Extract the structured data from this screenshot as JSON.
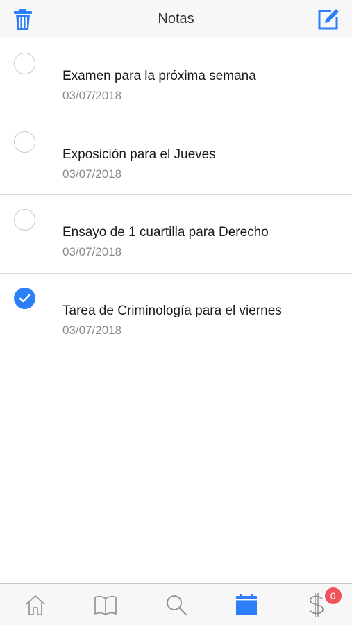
{
  "header": {
    "title": "Notas",
    "left_icon": "trash-icon",
    "right_icon": "compose-icon"
  },
  "notes": [
    {
      "title": "Examen para la próxima semana",
      "date": "03/07/2018",
      "done": false
    },
    {
      "title": "Exposición para el Jueves",
      "date": "03/07/2018",
      "done": false
    },
    {
      "title": "Ensayo de 1 cuartilla para Derecho",
      "date": "03/07/2018",
      "done": false
    },
    {
      "title": "Tarea de Criminología para el viernes",
      "date": "03/07/2018",
      "done": true
    }
  ],
  "tabbar": {
    "tabs": [
      {
        "icon": "home-icon",
        "active": false
      },
      {
        "icon": "book-icon",
        "active": false
      },
      {
        "icon": "search-icon",
        "active": false
      },
      {
        "icon": "calendar-icon",
        "active": true
      },
      {
        "icon": "dollar-icon",
        "active": false,
        "badge": "0"
      }
    ]
  },
  "colors": {
    "accent": "#2d7ff9",
    "inactive_icon": "#8e8e93",
    "badge": "#f0525a"
  }
}
